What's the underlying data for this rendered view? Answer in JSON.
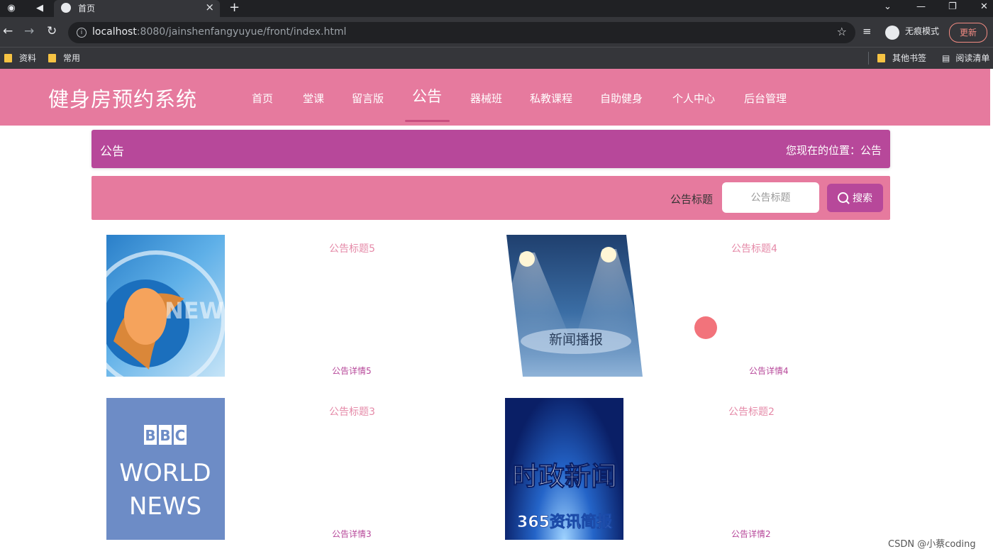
{
  "browser": {
    "tab_title": "首页",
    "url_host": "localhost",
    "url_rest": ":8080/jainshenfangyuyue/front/index.html",
    "incognito_label": "无痕模式",
    "update_label": "更新",
    "bookmarks": [
      "资料",
      "常用"
    ],
    "bookmarks_right": [
      "其他书签",
      "阅读清单"
    ]
  },
  "site": {
    "title": "健身房预约系统",
    "nav": [
      "首页",
      "堂课",
      "留言版",
      "公告",
      "器械班",
      "私教课程",
      "自助健身",
      "个人中心",
      "后台管理"
    ],
    "active_nav": "公告"
  },
  "breadcrumb": {
    "section": "公告",
    "location_label": "您现在的位置：公告"
  },
  "search": {
    "label": "公告标题",
    "placeholder": "公告标题",
    "button_label": "搜索"
  },
  "announcements": [
    {
      "title": "公告标题5",
      "detail": "公告详情5",
      "thumb": "news-globe-image"
    },
    {
      "title": "公告标题4",
      "detail": "公告详情4",
      "thumb": "spotlight-news-image",
      "thumb_text": "新闻播报"
    },
    {
      "title": "公告标题3",
      "detail": "公告详情3",
      "thumb": "bbc-world-news-image",
      "thumb_text": [
        "BBC",
        "WORLD",
        "NEWS"
      ]
    },
    {
      "title": "公告标题2",
      "detail": "公告详情2",
      "thumb": "current-affairs-news-image",
      "thumb_text": [
        "时政新闻",
        "365资讯简报"
      ]
    }
  ],
  "watermark": "CSDN @小蔡coding",
  "colors": {
    "header": "#e67a9e",
    "accent": "#b7489a",
    "title_pink": "#e58aa8"
  }
}
